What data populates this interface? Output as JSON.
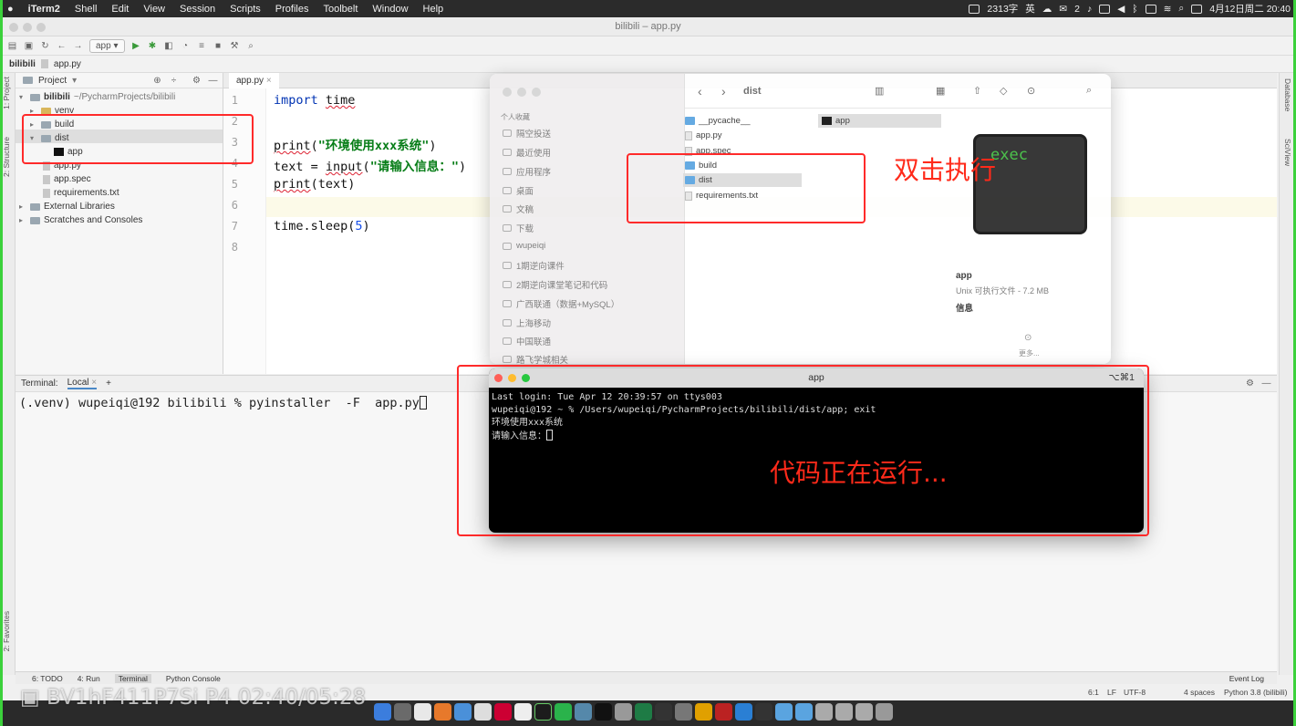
{
  "menubar": {
    "app_name": "iTerm2",
    "items": [
      "Shell",
      "Edit",
      "View",
      "Session",
      "Scripts",
      "Profiles",
      "Toolbelt",
      "Window",
      "Help"
    ],
    "status_text": "2313字",
    "input_method": "英",
    "notification_count": "2",
    "datetime": "4月12日周二 20:40"
  },
  "ide": {
    "window_title": "bilibili – app.py",
    "run_config": "app",
    "breadcrumb": {
      "project": "bilibili",
      "file": "app.py"
    },
    "left_strip": {
      "project": "1: Project",
      "structure": "2: Structure",
      "favorites": "2: Favorites"
    },
    "right_strip": {
      "database": "Database",
      "sciview": "SciView"
    },
    "project_panel": {
      "header": "Project",
      "root_name": "bilibili",
      "root_path": "~/PycharmProjects/bilibili",
      "items": {
        "venv": "venv",
        "build": "build",
        "dist": "dist",
        "app": "app",
        "app_py": "app.py",
        "app_spec": "app.spec",
        "requirements": "requirements.txt",
        "external": "External Libraries",
        "scratches": "Scratches and Consoles"
      }
    },
    "editor": {
      "tab": "app.py",
      "line_numbers": [
        "1",
        "2",
        "3",
        "4",
        "5",
        "6",
        "7",
        "8"
      ],
      "code": {
        "l1_kw": "import",
        "l1_mod": "time",
        "l3_fn": "print",
        "l3_str": "\"环境使用xxx系统\"",
        "l4_var": "text = ",
        "l4_fn": "input",
        "l4_str": "\"请输入信息：\"",
        "l5_fn": "print",
        "l5_arg": "(text)",
        "l7_call": "time.sleep(",
        "l7_num": "5",
        "l7_end": ")"
      }
    },
    "terminal": {
      "label": "Terminal:",
      "tab": "Local",
      "add": "+",
      "prompt": "(.venv) wupeiqi@192 bilibili % pyinstaller  -F  app.py"
    },
    "bottom_tabs": {
      "todo": "6: TODO",
      "run": "4: Run",
      "terminal": "Terminal",
      "console": "Python Console",
      "event_log": "Event Log"
    },
    "statusbar": {
      "position": "6:1",
      "line_sep": "LF",
      "encoding": "UTF-8",
      "indent": "4 spaces",
      "interpreter": "Python 3.8 (bilibili)"
    }
  },
  "finder": {
    "path": "dist",
    "sidebar_heading": "个人收藏",
    "sidebar": [
      "隔空投送",
      "最近使用",
      "应用程序",
      "桌面",
      "文稿",
      "下载",
      "wupeiqi",
      "1期逆向课件",
      "2期逆向课堂笔记和代码",
      "广西联通（数据+MySQL）",
      "上海移动",
      "中国联通",
      "路飞学城相关"
    ],
    "col1": {
      "pycache": "__pycache__",
      "app_py": "app.py",
      "app_spec": "app.spec",
      "build": "build",
      "dist": "dist",
      "requirements": "requirements.txt"
    },
    "col2": {
      "app": "app"
    },
    "preview": {
      "icon_text": "exec",
      "name": "app",
      "kind": "Unix 可执行文件 - 7.2 MB",
      "info": "信息",
      "more": "更多..."
    }
  },
  "iterm": {
    "title": "app",
    "shortcut": "⌥⌘1",
    "lines": [
      "Last login: Tue Apr 12 20:39:57 on ttys003",
      "wupeiqi@192 ~ % /Users/wupeiqi/PycharmProjects/bilibili/dist/app; exit",
      "环境使用xxx系统",
      "请输入信息："
    ]
  },
  "annotations": {
    "double_click": "双击执行",
    "running": "代码正在运行..."
  },
  "watermark": "BV1hF411P7Si P4 02:40/05:28",
  "colors": {
    "annotation_red": "#ff2a2a",
    "frame_green": "#3bd13b",
    "exec_green": "#3fbf3f"
  }
}
